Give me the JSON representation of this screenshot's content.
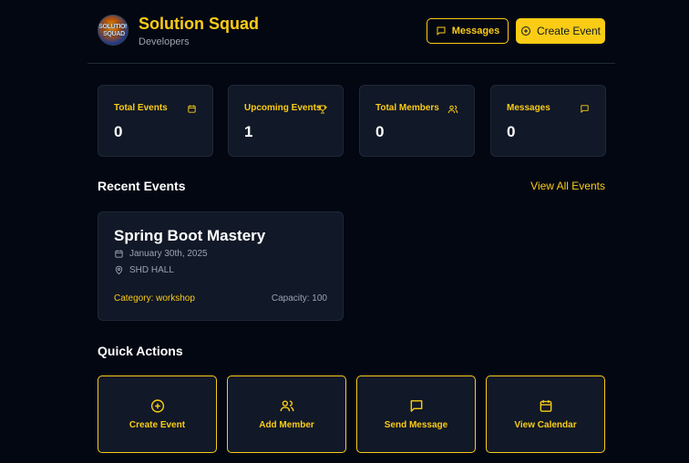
{
  "header": {
    "team_name": "Solution Squad",
    "team_subtitle": "Developers",
    "logo_text": "SOLUTION SQUAD",
    "messages_button": "Messages",
    "create_event_button": "Create Event"
  },
  "stats": [
    {
      "label": "Total Events",
      "value": "0",
      "icon": "calendar-icon"
    },
    {
      "label": "Upcoming Events",
      "value": "1",
      "icon": "trophy-icon"
    },
    {
      "label": "Total Members",
      "value": "0",
      "icon": "users-icon"
    },
    {
      "label": "Messages",
      "value": "0",
      "icon": "message-icon"
    }
  ],
  "recent_events": {
    "title": "Recent Events",
    "view_all": "View All Events",
    "events": [
      {
        "title": "Spring Boot Mastery",
        "date": "January 30th, 2025",
        "location": "SHD HALL",
        "category": "Category: workshop",
        "capacity": "Capacity: 100"
      }
    ]
  },
  "quick_actions": {
    "title": "Quick Actions",
    "items": [
      {
        "label": "Create Event",
        "icon": "plus-circle-icon"
      },
      {
        "label": "Add Member",
        "icon": "users-icon"
      },
      {
        "label": "Send Message",
        "icon": "message-icon"
      },
      {
        "label": "View Calendar",
        "icon": "calendar-icon"
      }
    ]
  },
  "colors": {
    "background": "#030712",
    "card": "#111827",
    "accent": "#facc15",
    "muted": "#9ca3af"
  }
}
